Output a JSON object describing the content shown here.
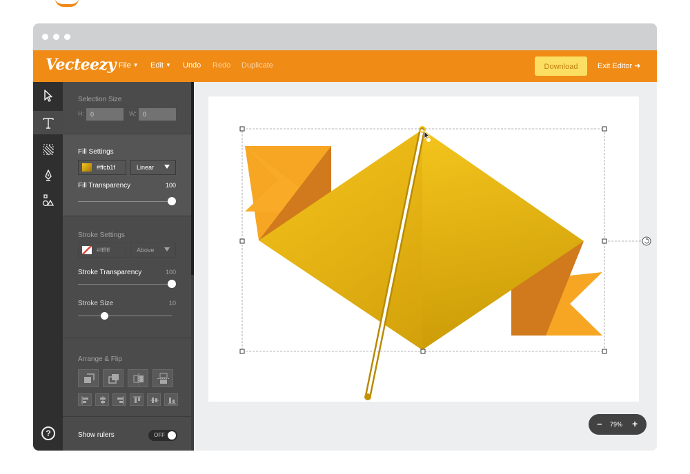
{
  "menubar": {
    "logo": "Vecteezy",
    "file": "File",
    "edit": "Edit",
    "undo": "Undo",
    "redo": "Redo",
    "duplicate": "Duplicate",
    "download": "Download",
    "exit_editor": "Exit Editor"
  },
  "tools": [
    "cursor-icon",
    "text-tool-icon",
    "image-trace-icon",
    "pen-tool-icon",
    "shapes-icon"
  ],
  "panel": {
    "selection": {
      "title": "Selection Size",
      "h_label": "H:",
      "h_value": "0",
      "w_label": "W:",
      "w_value": "0"
    },
    "fill": {
      "title": "Fill Settings",
      "color": "#ffcb1f",
      "type": "Linear",
      "transparency_label": "Fill Transparency",
      "transparency_value": "100"
    },
    "stroke": {
      "title": "Stroke Settings",
      "color": "#ffffff",
      "position": "Above",
      "transparency_label": "Stroke Transparency",
      "transparency_value": "100",
      "size_label": "Stroke Size",
      "size_value": "10"
    },
    "arrange": {
      "title": "Arrange & Flip"
    },
    "rulers": {
      "label": "Show rulers",
      "toggle": "OFF"
    }
  },
  "zoom": {
    "minus": "−",
    "value": "79%",
    "plus": "+"
  },
  "colors": {
    "accent": "#f08b16",
    "download_bg": "#fcdf62",
    "panel_bg": "#4b4b4c",
    "rail_bg": "#2f2f30",
    "flag_gold": "#f0bc1a",
    "ribbon_orange": "#f6a623"
  }
}
